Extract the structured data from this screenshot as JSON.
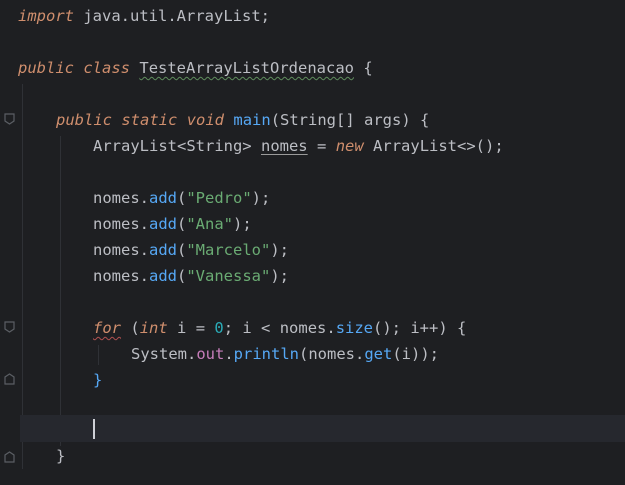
{
  "editor": {
    "lines": [
      {
        "import_kw": "import",
        "import_path": "java.util.ArrayList;"
      },
      {
        "mod": "public",
        "class_kw": "class",
        "class_name": "TesteArrayListOrdenacao",
        "brace": "{"
      },
      {
        "mod1": "public",
        "mod2": "static",
        "mod3": "void",
        "method": "main",
        "params": "(String[] args) {"
      },
      {
        "type": "ArrayList<String>",
        "var": "nomes",
        "eq": "=",
        "new_kw": "new",
        "ctor": "ArrayList<>();"
      },
      {
        "obj": "nomes.",
        "call": "add",
        "open": "(",
        "arg": "\"Pedro\"",
        "close": ");"
      },
      {
        "obj": "nomes.",
        "call": "add",
        "open": "(",
        "arg": "\"Ana\"",
        "close": ");"
      },
      {
        "obj": "nomes.",
        "call": "add",
        "open": "(",
        "arg": "\"Marcelo\"",
        "close": ");"
      },
      {
        "obj": "nomes.",
        "call": "add",
        "open": "(",
        "arg": "\"Vanessa\"",
        "close": ");"
      },
      {
        "for_kw": "for",
        "p1": "(",
        "int_kw": "int",
        "p2": "i = ",
        "zero": "0",
        "p3": "; i < nomes.",
        "size": "size",
        "p4": "(); i++) {"
      },
      {
        "sys": "System.",
        "out": "out",
        "dot": ".",
        "println": "println",
        "p1": "(nomes.",
        "get": "get",
        "p2": "(i));"
      },
      {
        "brace": "}"
      },
      {
        "brace": "}"
      }
    ]
  },
  "colors": {
    "background": "#1e1f22",
    "keyword": "#cf8e6d",
    "method": "#56a8f5",
    "string": "#6aab73",
    "number": "#2aacb8",
    "field": "#c77dbb",
    "text": "#bcbec4"
  },
  "icons": {
    "fold_marker": "fold-icon"
  }
}
